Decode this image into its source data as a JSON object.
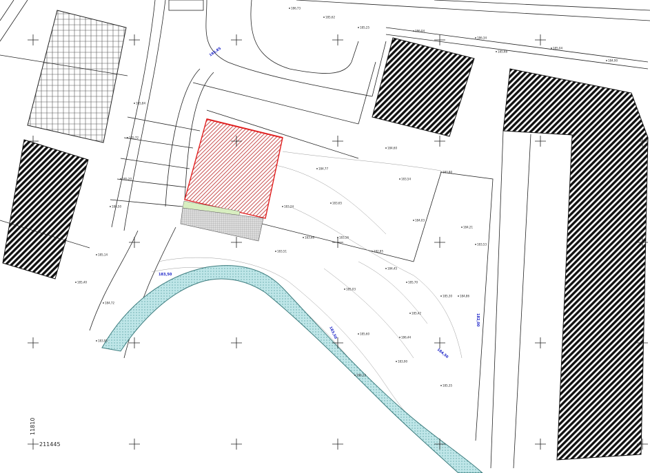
{
  "map": {
    "grid_coordinate_bottom": "211445",
    "grid_coordinate_left": "11810",
    "colors": {
      "building_hatch": "#111111",
      "parcel_outline": "#e02020",
      "parcel_hatch": "#c85050",
      "lawn": "#d8eec0",
      "paving": "#cccccc",
      "stream": "#bfe6e8",
      "stream_outline": "#3a7a7c",
      "label_blue": "#1a22c8",
      "linework": "#222222"
    },
    "blue_labels": [
      "185,85",
      "183,50",
      "183,50",
      "182,00",
      "184,50"
    ],
    "elevations": [
      "186,73",
      "185,62",
      "185,25",
      "186,04",
      "186,34",
      "185,68",
      "185,04",
      "184,90",
      "185,84",
      "185,72",
      "185,20",
      "186,50",
      "185,14",
      "185,40",
      "184,72",
      "183,95",
      "184,77",
      "183,65",
      "184,60",
      "183,54",
      "184,03",
      "183,80",
      "184,21",
      "183,53",
      "183,24",
      "183,66",
      "183,51",
      "183,56",
      "182,85",
      "184,45",
      "185,70",
      "185,03",
      "185,60",
      "186,44",
      "185,42",
      "185,30",
      "184,86",
      "183,90",
      "186,12",
      "185,35"
    ]
  }
}
